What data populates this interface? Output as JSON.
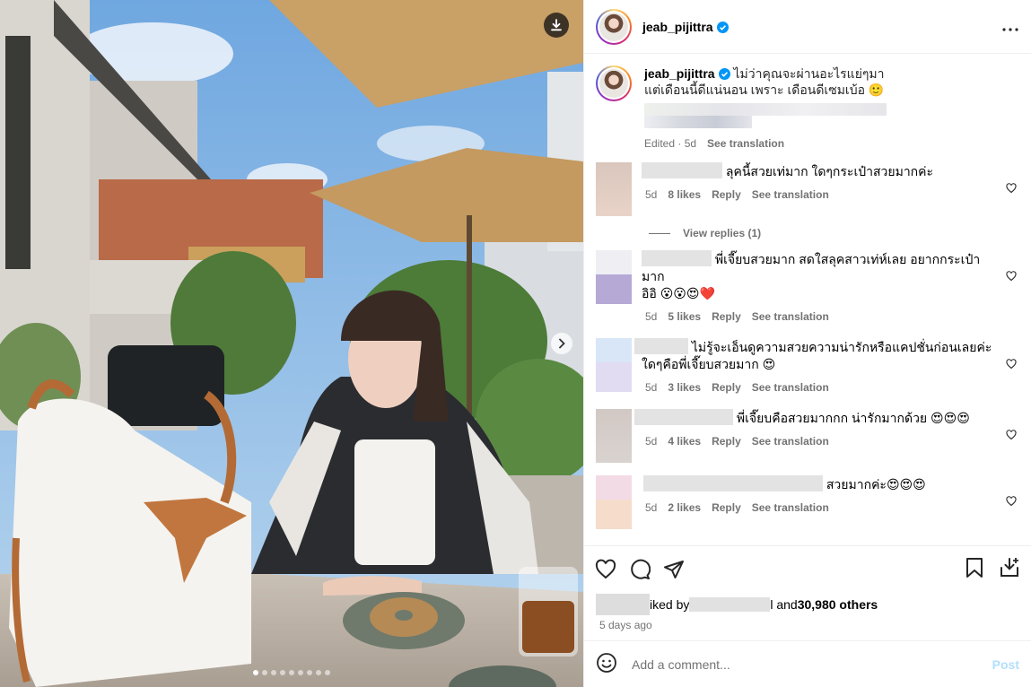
{
  "post": {
    "author": "jeab_pijittra",
    "verified": true,
    "more_label": "•••"
  },
  "caption": {
    "line1": "ไม่ว่าคุณจะผ่านอะไรแย่ๆมา",
    "line2": "แต่เดือนนี้ดีแน่นอน เพราะ เดือนดีเซมเบ้อ 🙂",
    "edited": "Edited · 5d",
    "see_translation": "See translation"
  },
  "comments": [
    {
      "text": "ลุคนี้สวยเท่มาก ใดๆกระเป๋าสวยมากค่ะ",
      "time": "5d",
      "likes": "8 likes",
      "reply": "Reply",
      "translate": "See translation"
    },
    {
      "text": "พี่เจี๊ยบสวยมาก สดใสลุคสาวเท่ห์เลย อยากกระเป๋ามาก",
      "text2": "อิอิ 😮😮😍❤️",
      "time": "5d",
      "likes": "5 likes",
      "reply": "Reply",
      "translate": "See translation"
    },
    {
      "text": "ไม่รู้จะเอ็นดูความสวยความน่ารักหรือแคปชั่นก่อนเลยค่ะ",
      "text2": "ใดๆคือพี่เจี๊ยบสวยมาก 😍",
      "time": "5d",
      "likes": "3 likes",
      "reply": "Reply",
      "translate": "See translation"
    },
    {
      "text": "พี่เจี๊ยบคือสวยมากกก น่ารักมากด้วย 😍😍😍",
      "time": "5d",
      "likes": "4 likes",
      "reply": "Reply",
      "translate": "See translation"
    },
    {
      "text": "สวยมากค่ะ😍😍😍",
      "time": "5d",
      "likes": "2 likes",
      "reply": "Reply",
      "translate": "See translation"
    }
  ],
  "view_replies": "View replies (1)",
  "likes_line": {
    "prefix": "iked by ",
    "middle": "l and ",
    "count": "30,980 others"
  },
  "posted_ago": "5 days ago",
  "composer": {
    "placeholder": "Add a comment...",
    "post_label": "Post"
  },
  "carousel": {
    "total": 9,
    "active_index": 0
  },
  "icons": [
    "download-icon",
    "chevron-right-icon",
    "verified-badge-icon",
    "more-icon",
    "heart-icon",
    "comment-icon",
    "share-icon",
    "bookmark-icon",
    "save-to-collection-icon",
    "emoji-icon"
  ],
  "colors": {
    "verified": "#0095f6",
    "secondary_text": "#737373",
    "post_disabled": "#b2dffc",
    "umbrella": "#c9a066"
  }
}
